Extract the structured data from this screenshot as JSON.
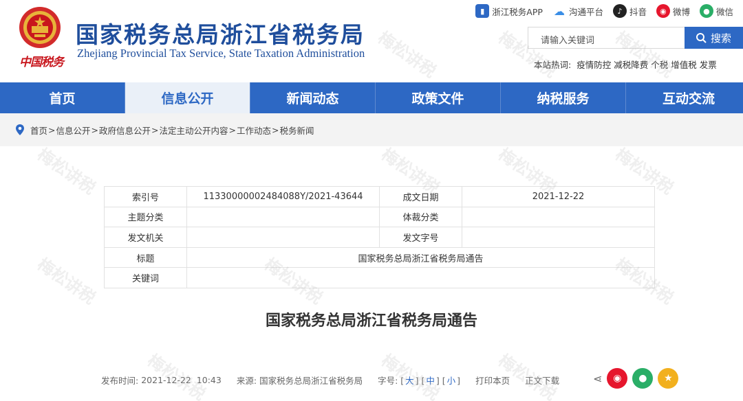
{
  "header": {
    "emblem_text": "中国税务",
    "title": "国家税务总局浙江省税务局",
    "subtitle": "Zhejiang Provincial Tax Service, State Taxation Administration"
  },
  "social": [
    {
      "label": "浙江税务APP",
      "icon": "app-icon",
      "color": "#2d68c4"
    },
    {
      "label": "沟通平台",
      "icon": "cloud-icon",
      "color": "#3a8ee6"
    },
    {
      "label": "抖音",
      "icon": "tiktok-icon",
      "color": "#222222"
    },
    {
      "label": "微博",
      "icon": "weibo-icon",
      "color": "#e6162d"
    },
    {
      "label": "微信",
      "icon": "wechat-icon",
      "color": "#2aae67"
    }
  ],
  "search": {
    "placeholder": "请输入关键词",
    "button": "搜索"
  },
  "hot": {
    "label": "本站热词:",
    "items": [
      "疫情防控",
      "减税降费",
      "个税",
      "增值税",
      "发票"
    ]
  },
  "nav": [
    "首页",
    "信息公开",
    "新闻动态",
    "政策文件",
    "纳税服务",
    "互动交流"
  ],
  "nav_active": 1,
  "breadcrumb": [
    "首页",
    "信息公开",
    "政府信息公开",
    "法定主动公开内容",
    "工作动态",
    "税务新闻"
  ],
  "meta": {
    "index_label": "索引号",
    "index_value": "11330000002484088Y/2021-43644",
    "date_label": "成文日期",
    "date_value": "2021-12-22",
    "topic_label": "主题分类",
    "topic_value": "",
    "genre_label": "体裁分类",
    "genre_value": "",
    "issuer_label": "发文机关",
    "issuer_value": "",
    "docno_label": "发文字号",
    "docno_value": "",
    "title_label": "标题",
    "title_value": "国家税务总局浙江省税务局通告",
    "keywords_label": "关键词",
    "keywords_value": ""
  },
  "article": {
    "title": "国家税务总局浙江省税务局通告",
    "publish_label": "发布时间:",
    "publish_time": "2021-12-22  10:43",
    "source_label": "来源:",
    "source": "国家税务总局浙江省税务局",
    "fontsize_label": "字号:",
    "font_large": "大",
    "font_medium": "中",
    "font_small": "小",
    "print": "打印本页",
    "download": "正文下载"
  },
  "watermark": "梅松讲税",
  "colors": {
    "brand": "#2d68c4",
    "title_blue": "#1f4e9c",
    "red": "#c8161d"
  }
}
